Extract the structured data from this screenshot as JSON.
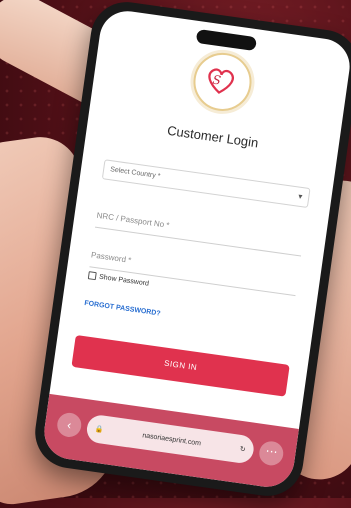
{
  "login": {
    "title": "Customer Login",
    "select_country_label": "Select Country *",
    "nrc_placeholder": "NRC / Passport No *",
    "password_placeholder": "Password *",
    "show_password_label": "Show Password",
    "forgot_password": "FORGOT PASSWORD?",
    "sign_in": "SIGN IN"
  },
  "browser": {
    "url": "nasoriaesprint.com"
  },
  "colors": {
    "accent": "#e0324e",
    "bottom_bar": "#c84a62",
    "link": "#2a6fd1"
  },
  "icons": {
    "back": "chevron-left-icon",
    "url": "lock-icon",
    "reload": "reload-icon",
    "more": "more-icon"
  }
}
